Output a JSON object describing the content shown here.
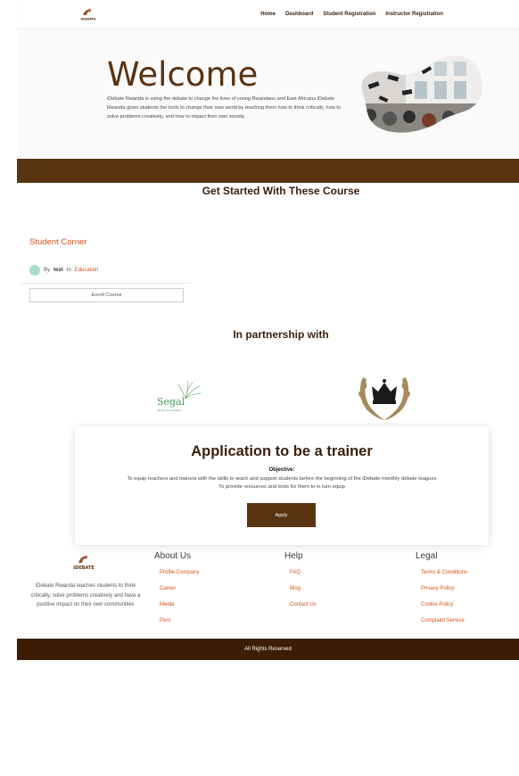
{
  "header": {
    "logo_text": "IDEBATE",
    "nav": [
      "Home",
      "Dashboard",
      "Student Registration",
      "Instructor Registration"
    ]
  },
  "hero": {
    "title": "Welcome",
    "text": "iDebate Rwanda is using the debate to change the lives of young Rwandans and East Africans.iDebate Rwanda gives students the tools to change their own world by teaching them how to think critically, how to solve problems creatively, and how to impact their own society."
  },
  "courses": {
    "title": "Get Started With These Course",
    "items": [
      {
        "title": "Student Corner",
        "by": "By",
        "author": "test",
        "in": "In",
        "category": "Education",
        "enroll_label": "Enroll Course"
      }
    ]
  },
  "partners": {
    "title": "In partnership with",
    "segal_name": "Segal",
    "segal_sub": "Family Foundation"
  },
  "trainer": {
    "title": "Application to be a trainer",
    "objective_label": "Objective:",
    "objective_line1": "To equip teachers and trainers with the skills to teach and support students before the beginning of the iDebate monthly debate leagues",
    "objective_line2": "To provide resources and tools for them to in turn equip",
    "apply_label": "Apply"
  },
  "footer": {
    "logo_text": "IDEBATE",
    "about_text": "iDebate Rwanda teaches students to think critically, solve problems creatively and have a positive impact on their own communities",
    "columns": [
      {
        "title": "About Us",
        "links": [
          "Profile Company",
          "Career",
          "Media",
          "Pers"
        ]
      },
      {
        "title": "Help",
        "links": [
          "FAQ",
          "Blog",
          "Contact Us"
        ]
      },
      {
        "title": "Legal",
        "links": [
          "Terms & Conditions",
          "Privacy Policy",
          "Cookie Policy",
          "Complaint Service"
        ]
      }
    ],
    "copyright": "All Rights Reserved"
  },
  "colors": {
    "brand_brown": "#5a3410",
    "dark_brown": "#3d1d05",
    "accent_orange": "#d2521a"
  }
}
